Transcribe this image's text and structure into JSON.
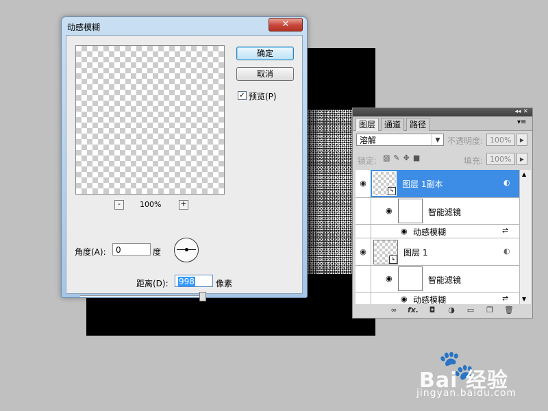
{
  "dialog": {
    "title": "动感模糊",
    "close_glyph": "✕",
    "ok_label": "确定",
    "cancel_label": "取消",
    "preview_label": "预览(P)",
    "preview_checked": true,
    "zoom_out": "-",
    "zoom_in": "+",
    "zoom_level": "100%",
    "angle_label": "角度(A):",
    "angle_value": "0",
    "angle_unit": "度",
    "distance_label": "距离(D):",
    "distance_value": "998",
    "distance_unit": "像素",
    "distance_slider_fraction": 0.998
  },
  "layers_panel": {
    "top_controls": "◂◂ ✕",
    "tabs": [
      "图层",
      "通道",
      "路径"
    ],
    "active_tab": 0,
    "menu_glyph": "▾≡",
    "blend_mode": "溶解",
    "opacity_label": "不透明度:",
    "opacity_value": "100%",
    "lock_label": "锁定:",
    "fill_label": "填充:",
    "fill_value": "100%",
    "layers": [
      {
        "name": "图层 1副本",
        "selected": true
      },
      {
        "name": "智能滤镜",
        "type": "filter-mask"
      },
      {
        "name": "动感模糊",
        "type": "filter"
      },
      {
        "name": "图层 1",
        "selected": false
      },
      {
        "name": "智能滤镜",
        "type": "filter-mask"
      },
      {
        "name": "动感模糊",
        "type": "filter"
      }
    ],
    "bottom_icons": [
      "link-icon",
      "fx-icon",
      "mask-icon",
      "adjustment-icon",
      "folder-icon",
      "new-layer-icon",
      "trash-icon"
    ],
    "fx_label": "fx."
  },
  "watermark": {
    "brand": "Bai  经验",
    "url": "jingyan.baidu.com"
  }
}
